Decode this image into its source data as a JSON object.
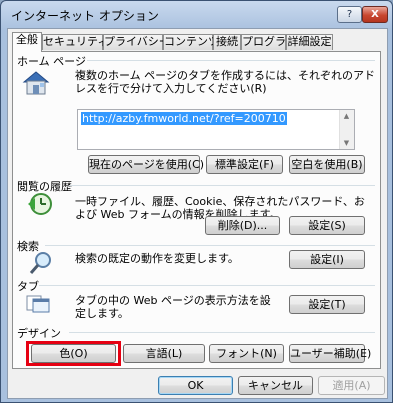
{
  "window": {
    "title": "インターネット オプション",
    "help_label": "?",
    "close_label": "X"
  },
  "tabs": [
    {
      "label": "全般",
      "active": true
    },
    {
      "label": "セキュリティ",
      "active": false
    },
    {
      "label": "プライバシー",
      "active": false
    },
    {
      "label": "コンテンツ",
      "active": false
    },
    {
      "label": "接続",
      "active": false
    },
    {
      "label": "プログラム",
      "active": false
    },
    {
      "label": "詳細設定",
      "active": false
    }
  ],
  "homepage": {
    "heading": "ホーム ページ",
    "description": "複数のホーム ページのタブを作成するには、それぞれのアドレスを行で分けて入力してください(R)",
    "url": "http://azby.fmworld.net/?ref=200710",
    "buttons": [
      "現在のページを使用(C)",
      "標準設定(F)",
      "空白を使用(B)"
    ]
  },
  "history": {
    "heading": "閲覧の履歴",
    "description": "一時ファイル、履歴、Cookie、保存されたパスワード、および Web フォームの情報を削除します。",
    "buttons": [
      "削除(D)...",
      "設定(S)"
    ]
  },
  "search": {
    "heading": "検索",
    "description": "検索の既定の動作を変更します。",
    "button": "設定(I)"
  },
  "tabs_section": {
    "heading": "タブ",
    "description": "タブの中の Web ページの表示方法を設定します。",
    "button": "設定(T)"
  },
  "design": {
    "heading": "デザイン",
    "buttons": [
      "色(O)",
      "言語(L)",
      "フォント(N)",
      "ユーザー補助(E)"
    ],
    "highlighted": "色(O)",
    "highlight_color": "#e60012"
  },
  "footer": {
    "ok": "OK",
    "cancel": "キャンセル",
    "apply": "適用(A)"
  },
  "icons": {
    "homepage": "house-icon",
    "history": "green-clock-arrow-icon",
    "search": "magnifier-icon",
    "tabs": "tab-pages-icon"
  }
}
